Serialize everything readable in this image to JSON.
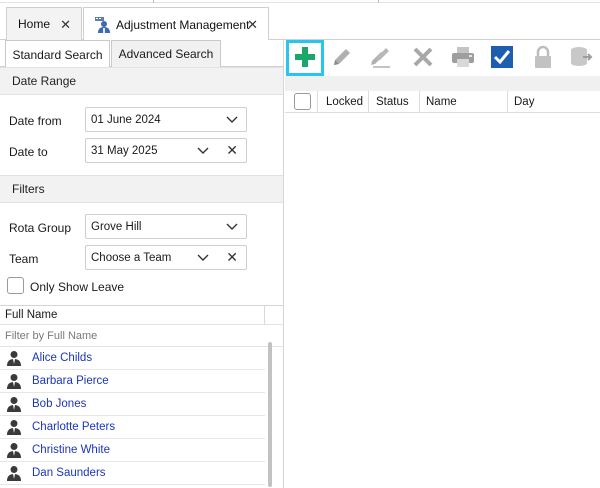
{
  "tabs": {
    "home_label": "Home",
    "adjustment_label": "Adjustment Management"
  },
  "search_tabs": {
    "standard": "Standard Search",
    "advanced": "Advanced Search"
  },
  "date_range": {
    "heading": "Date Range",
    "from_label": "Date from",
    "from_value": "01 June 2024",
    "to_label": "Date to",
    "to_value": "31 May 2025"
  },
  "filters": {
    "heading": "Filters",
    "rota_group_label": "Rota Group",
    "rota_group_value": "Grove Hill",
    "team_label": "Team",
    "team_value": "Choose a Team",
    "only_show_leave_label": "Only Show Leave",
    "only_show_leave_checked": false
  },
  "people_list": {
    "column_header": "Full Name",
    "filter_placeholder": "Filter by Full Name",
    "rows": [
      "Alice Childs",
      "Barbara Pierce",
      "Bob Jones",
      "Charlotte Peters",
      "Christine White",
      "Dan Saunders"
    ]
  },
  "toolbar": {
    "buttons": [
      "plus-icon",
      "pencil-icon",
      "multi-edit-icon",
      "delete-icon",
      "printer-icon",
      "checkbox-icon",
      "lock-icon",
      "database-icon"
    ],
    "colors": {
      "add": "#1aa86a",
      "selection_outline": "#26c6f0",
      "check": "#1d5fae",
      "disabled": "#b0b0b0"
    }
  },
  "grid": {
    "columns": [
      "Locked",
      "Status",
      "Name",
      "Day"
    ]
  },
  "colors": {
    "link": "#1c35b8",
    "section_header_bg": "#f2f2f2"
  }
}
